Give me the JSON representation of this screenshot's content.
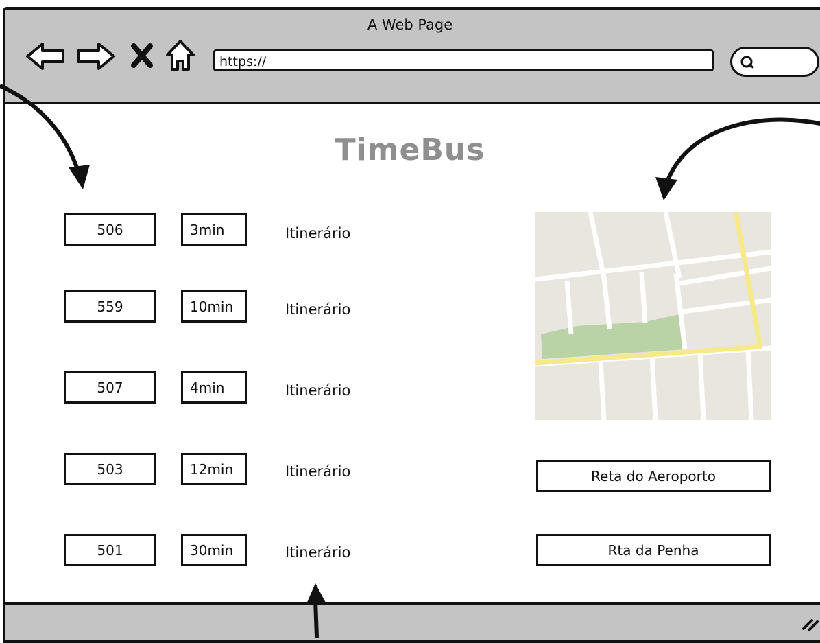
{
  "window": {
    "title": "A Web Page",
    "url": "https://"
  },
  "app": {
    "title": "TimeBus"
  },
  "buses": [
    {
      "route": "506",
      "eta": "3min",
      "itinerary": "Itinerário"
    },
    {
      "route": "559",
      "eta": "10min",
      "itinerary": "Itinerário"
    },
    {
      "route": "507",
      "eta": "4min",
      "itinerary": "Itinerário"
    },
    {
      "route": "503",
      "eta": "12min",
      "itinerary": "Itinerário"
    },
    {
      "route": "501",
      "eta": "30min",
      "itinerary": "Itinerário"
    }
  ],
  "stops": [
    {
      "label": "Reta do Aeroporto"
    },
    {
      "label": "Rta da Penha"
    }
  ],
  "icons": {
    "back": "arrow-left-icon",
    "forward": "arrow-right-icon",
    "stop": "close-icon",
    "home": "home-icon",
    "search": "search-icon",
    "resize": "resize-grip-icon"
  },
  "colors": {
    "chrome": "#c4c4c4",
    "title": "#8f8f8f",
    "map_bg": "#e9e6df",
    "map_park": "#b9d2a6",
    "map_highway": "#f6e98a"
  }
}
